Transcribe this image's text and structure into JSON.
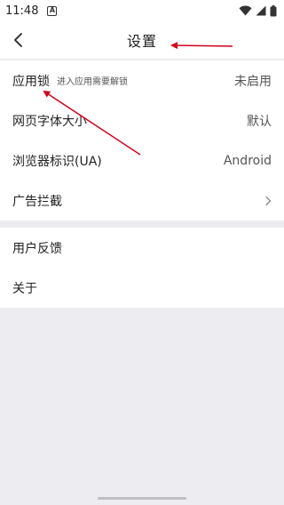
{
  "status_bar": {
    "time": "11:48",
    "notification_badge": "A",
    "icons": [
      "wifi-icon",
      "signal-icon",
      "battery-icon"
    ]
  },
  "header": {
    "title": "设置",
    "back_icon": "chevron-left-icon"
  },
  "settings": {
    "group1": [
      {
        "label": "应用锁",
        "sub": "进入应用需要解锁",
        "value": "未启用"
      },
      {
        "label": "网页字体大小",
        "value": "默认"
      },
      {
        "label": "浏览器标识(UA)",
        "value": "Android"
      },
      {
        "label": "广告拦截",
        "chevron": "chevron-right-icon"
      }
    ],
    "group2": [
      {
        "label": "用户反馈"
      },
      {
        "label": "关于"
      }
    ]
  },
  "colors": {
    "background": "#ececf1",
    "surface": "#ffffff",
    "annotation_arrow": "#d0021b"
  }
}
